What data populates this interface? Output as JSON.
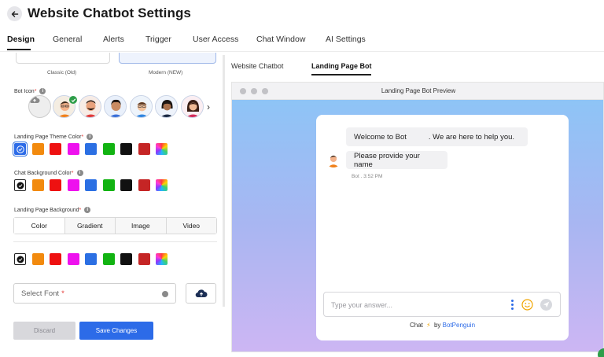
{
  "header": {
    "title": "Website Chatbot Settings",
    "back_icon": "arrow-left-icon"
  },
  "tabs": [
    {
      "label": "Design",
      "active": true
    },
    {
      "label": "General"
    },
    {
      "label": "Alerts"
    },
    {
      "label": "Trigger"
    },
    {
      "label": "User Access"
    },
    {
      "label": "Chat Window"
    },
    {
      "label": "AI Settings"
    }
  ],
  "layout_options": {
    "classic_label": "Classic (Old)",
    "modern_label": "Modern (NEW)"
  },
  "bot_icon": {
    "label": "Bot Icon",
    "required_mark": "*"
  },
  "theme_color": {
    "label": "Landing Page Theme Color",
    "required_mark": "*"
  },
  "chat_bg_color": {
    "label": "Chat Background Color",
    "required_mark": "*"
  },
  "landing_bg": {
    "label": "Landing Page Background",
    "required_mark": "*",
    "options": [
      "Color",
      "Gradient",
      "Image",
      "Video"
    ]
  },
  "colors": {
    "accent": "#2c6be8",
    "swatches": [
      "#f28a0e",
      "#ee1111",
      "#ee11ee",
      "#2b6fe3",
      "#12b312",
      "#111111",
      "#c52525"
    ]
  },
  "font": {
    "placeholder": "Select Font",
    "required_mark": "*"
  },
  "actions": {
    "discard_label": "Discard",
    "save_label": "Save Changes"
  },
  "preview_tabs": [
    {
      "label": "Website Chatbot"
    },
    {
      "label": "Landing Page Bot",
      "active": true
    }
  ],
  "preview": {
    "window_title": "Landing Page Bot Preview",
    "welcome_part1": "Welcome to Bot",
    "welcome_part2": ". We are here to help you.",
    "message2": "Please provide your name",
    "timestamp": "Bot . 3:52 PM",
    "input_placeholder": "Type your answer...",
    "footer_prefix": "Chat",
    "footer_by": "by",
    "footer_brand": "BotPenguin"
  }
}
